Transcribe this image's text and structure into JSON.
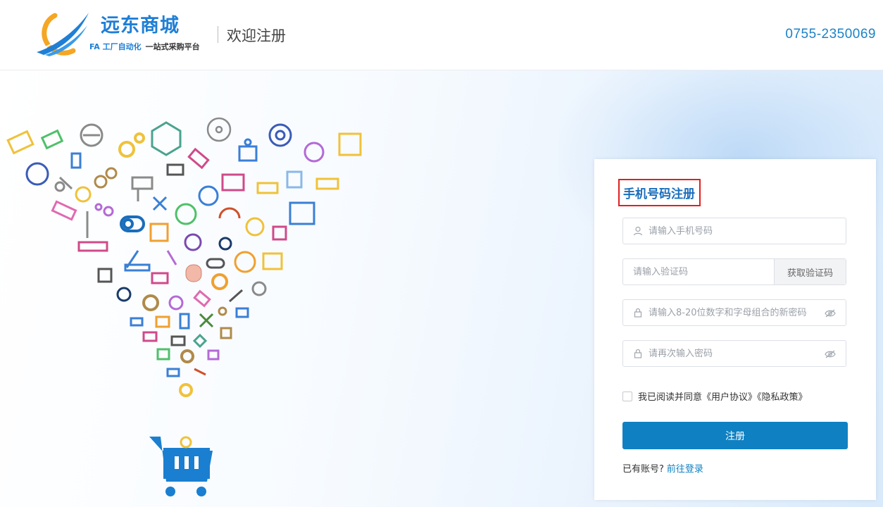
{
  "header": {
    "brand_name": "远东商城",
    "tagline_fa": "FA 工厂自动化",
    "tagline_rest": "一站式采购平台",
    "welcome": "欢迎注册",
    "phone": "0755-2350069"
  },
  "form": {
    "title": "手机号码注册",
    "phone_placeholder": "请输入手机号码",
    "code_placeholder": "请输入验证码",
    "get_code_label": "获取验证码",
    "password_placeholder": "请输入8-20位数字和字母组合的新密码",
    "confirm_placeholder": "请再次输入密码",
    "agree_prefix": "我已阅读并同意",
    "user_agreement": "《用户协议》",
    "privacy_policy": "《隐私政策》",
    "submit_label": "注册",
    "has_account": "已有账号?",
    "login_link": "前往登录"
  },
  "colors": {
    "brand_blue": "#1f7fd6",
    "button_blue": "#0f81c3",
    "highlight_red": "#e02020"
  }
}
